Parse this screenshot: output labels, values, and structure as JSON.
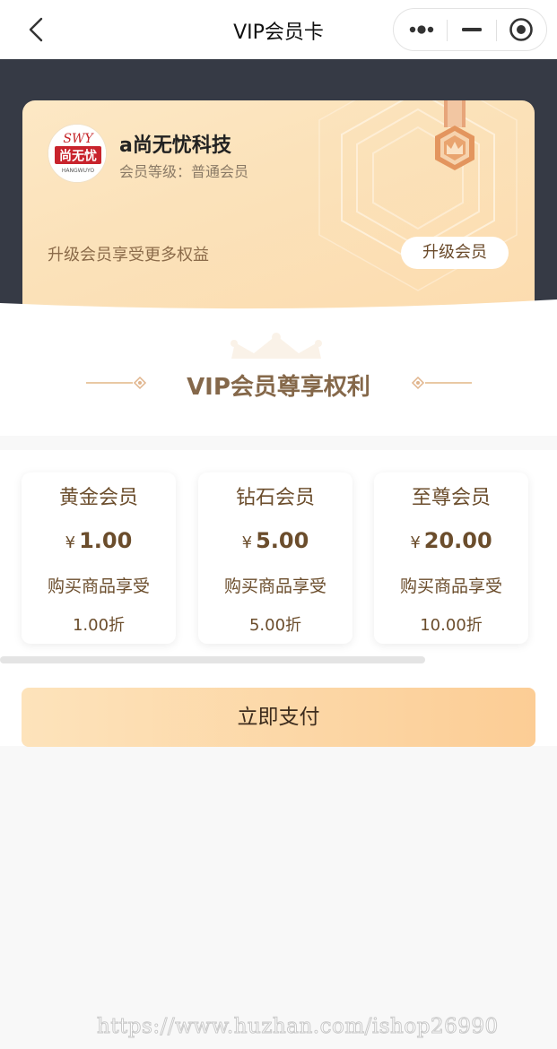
{
  "nav": {
    "title": "VIP会员卡",
    "back_icon": "chevron-left-icon",
    "more_icon": "more-dots-icon",
    "minimize_icon": "minimize-icon",
    "close_icon": "target-circle-icon"
  },
  "card": {
    "logo_text_top": "SWY",
    "logo_text_main": "尚无忧",
    "logo_text_bottom": "HANGWUYO",
    "company": "a尚无忧科技",
    "level_label": "会员等级：",
    "level_value": "普通会员",
    "upgrade_tip": "升级会员享受更多权益",
    "upgrade_button": "升级会员",
    "medal_icon": "crown-medal-icon"
  },
  "section": {
    "title": "VIP会员尊享权利",
    "crown_icon": "crown-icon"
  },
  "plans": [
    {
      "name": "黄金会员",
      "currency": "¥",
      "price": "1.00",
      "desc": "购买商品享受",
      "discount": "1.00折"
    },
    {
      "name": "钻石会员",
      "currency": "¥",
      "price": "5.00",
      "desc": "购买商品享受",
      "discount": "5.00折"
    },
    {
      "name": "至尊会员",
      "currency": "¥",
      "price": "20.00",
      "desc": "购买商品享受",
      "discount": "10.00折"
    }
  ],
  "pay_button": "立即支付",
  "watermark": "https://www.huzhan.com/ishop26990",
  "colors": {
    "header_dark": "#363a45",
    "card_gold": "#fde8c5",
    "brown_text": "#6b4d2c",
    "pay_gradient_end": "#fccd95"
  }
}
